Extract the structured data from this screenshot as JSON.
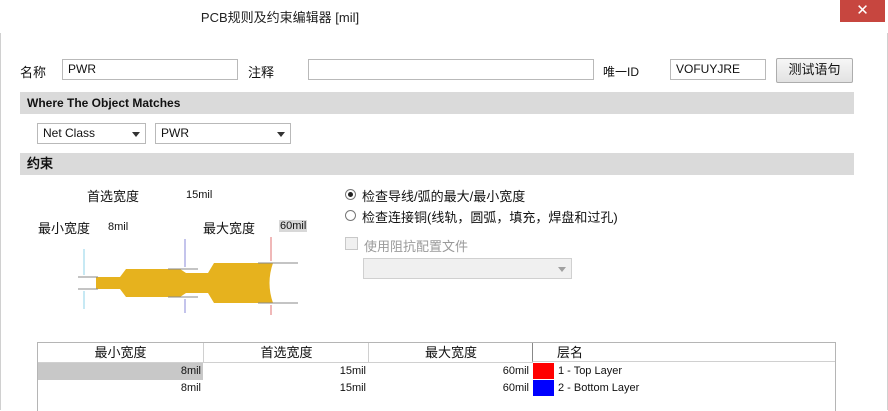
{
  "window": {
    "title": "PCB规则及约束编辑器 [mil]",
    "close_glyph": "✕"
  },
  "header": {
    "name_label": "名称",
    "name_value": "PWR",
    "comment_label": "注释",
    "comment_value": "",
    "uid_label": "唯一ID",
    "uid_value": "VOFUYJRE",
    "test_button": "测试语句"
  },
  "match": {
    "section_title": "Where The Object Matches",
    "type_select": "Net Class",
    "value_select": "PWR"
  },
  "constraints": {
    "section_title": "约束",
    "preferred_label": "首选宽度",
    "preferred_value": "15mil",
    "min_label": "最小宽度",
    "min_value": "8mil",
    "max_label": "最大宽度",
    "max_value": "60mil",
    "radio_check_track": "检查导线/弧的最大/最小宽度",
    "radio_check_copper": "检查连接铜(线轨，圆弧，填充，焊盘和过孔)",
    "radio_selected": "check_track",
    "impedance_checkbox": "使用阻抗配置文件",
    "impedance_select": "",
    "trace_color": "#e6b21e"
  },
  "layer_table": {
    "headers": [
      "最小宽度",
      "首选宽度",
      "最大宽度",
      "层名"
    ],
    "rows": [
      {
        "min": "8mil",
        "pref": "15mil",
        "max": "60mil",
        "layer": "1 - Top Layer",
        "color": "#ff0000"
      },
      {
        "min": "8mil",
        "pref": "15mil",
        "max": "60mil",
        "layer": "2 - Bottom Layer",
        "color": "#0000ff"
      }
    ]
  }
}
